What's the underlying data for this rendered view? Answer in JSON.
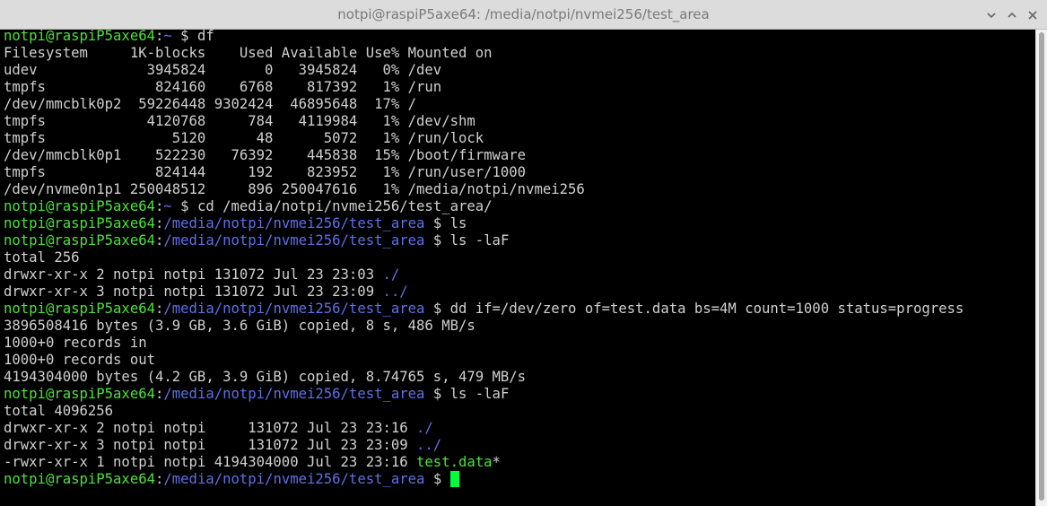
{
  "window": {
    "title": "notpi@raspiP5axe64: /media/notpi/nvmei256/test_area"
  },
  "prompt": {
    "user_host": "notpi@raspiP5axe64",
    "sep": ":",
    "home_path": "~",
    "area_path": "/media/notpi/nvmei256/test_area",
    "dollar": " $ "
  },
  "commands": {
    "df": "df",
    "cd": "cd /media/notpi/nvmei256/test_area/",
    "ls": "ls",
    "lsla": "ls -laF",
    "dd": "dd if=/dev/zero of=test.data bs=4M count=1000 status=progress"
  },
  "df_output": [
    "Filesystem     1K-blocks    Used Available Use% Mounted on",
    "udev             3945824       0   3945824   0% /dev",
    "tmpfs             824160    6768    817392   1% /run",
    "/dev/mmcblk0p2  59226448 9302424  46895648  17% /",
    "tmpfs            4120768     784   4119984   1% /dev/shm",
    "tmpfs               5120      48      5072   1% /run/lock",
    "/dev/mmcblk0p1    522230   76392    445838  15% /boot/firmware",
    "tmpfs             824144     192    823952   1% /run/user/1000",
    "/dev/nvme0n1p1 250048512     896 250047616   1% /media/notpi/nvmei256"
  ],
  "ls1": {
    "total": "total 256",
    "rows": [
      {
        "prefix": "drwxr-xr-x 2 notpi notpi 131072 Jul 23 23:03 ",
        "name": "./"
      },
      {
        "prefix": "drwxr-xr-x 3 notpi notpi 131072 Jul 23 23:09 ",
        "name": "../"
      }
    ]
  },
  "dd_output": [
    "3896508416 bytes (3.9 GB, 3.6 GiB) copied, 8 s, 486 MB/s",
    "1000+0 records in",
    "1000+0 records out",
    "4194304000 bytes (4.2 GB, 3.9 GiB) copied, 8.74765 s, 479 MB/s"
  ],
  "ls2": {
    "total": "total 4096256",
    "rows": [
      {
        "prefix": "drwxr-xr-x 2 notpi notpi     131072 Jul 23 23:16 ",
        "name": "./"
      },
      {
        "prefix": "drwxr-xr-x 3 notpi notpi     131072 Jul 23 23:09 ",
        "name": "../"
      },
      {
        "prefix": "-rwxr-xr-x 1 notpi notpi 4194304000 Jul 23 23:16 ",
        "name": "test.data",
        "suffix": "*"
      }
    ]
  },
  "colors": {
    "background": "#000000",
    "text": "#d0d0d0",
    "prompt_user": "#4ce13b",
    "prompt_path": "#5f6fe8",
    "cursor": "#00ff3a"
  },
  "icons": [
    "minimize-icon",
    "maximize-icon",
    "close-icon"
  ]
}
